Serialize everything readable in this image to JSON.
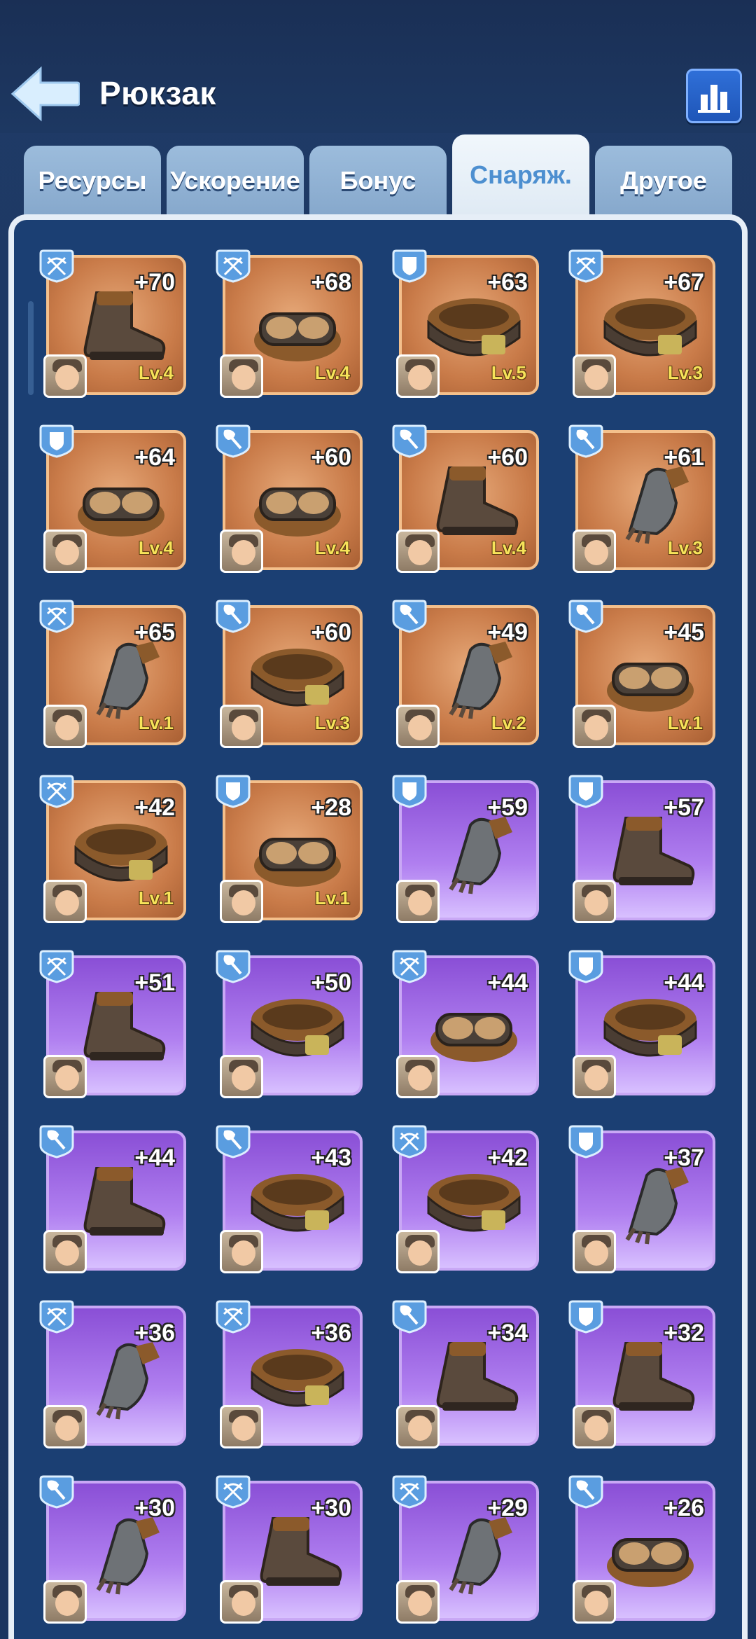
{
  "header": {
    "title": "Рюкзак",
    "back_icon": "back-arrow-icon",
    "stats_icon": "bar-chart-icon"
  },
  "tabs": [
    {
      "label": "Ресурсы",
      "active": false
    },
    {
      "label": "Ускорение",
      "active": false
    },
    {
      "label": "Бонус",
      "active": false
    },
    {
      "label": "Снаряж.",
      "active": true
    },
    {
      "label": "Другое",
      "active": false
    }
  ],
  "items": [
    {
      "bonus": "+70",
      "level": "Lv.4",
      "rarity": "orange",
      "type": "crossbow",
      "gear": "boot"
    },
    {
      "bonus": "+68",
      "level": "Lv.4",
      "rarity": "orange",
      "type": "crossbow",
      "gear": "goggles"
    },
    {
      "bonus": "+63",
      "level": "Lv.5",
      "rarity": "orange",
      "type": "shield",
      "gear": "belt"
    },
    {
      "bonus": "+67",
      "level": "Lv.3",
      "rarity": "orange",
      "type": "crossbow",
      "gear": "belt"
    },
    {
      "bonus": "+64",
      "level": "Lv.4",
      "rarity": "orange",
      "type": "shield",
      "gear": "goggles"
    },
    {
      "bonus": "+60",
      "level": "Lv.4",
      "rarity": "orange",
      "type": "shovel",
      "gear": "goggles"
    },
    {
      "bonus": "+60",
      "level": "Lv.4",
      "rarity": "orange",
      "type": "shovel",
      "gear": "boot"
    },
    {
      "bonus": "+61",
      "level": "Lv.3",
      "rarity": "orange",
      "type": "shovel",
      "gear": "glove"
    },
    {
      "bonus": "+65",
      "level": "Lv.1",
      "rarity": "orange",
      "type": "crossbow",
      "gear": "glove"
    },
    {
      "bonus": "+60",
      "level": "Lv.3",
      "rarity": "orange",
      "type": "shovel",
      "gear": "belt"
    },
    {
      "bonus": "+49",
      "level": "Lv.2",
      "rarity": "orange",
      "type": "shovel",
      "gear": "glove"
    },
    {
      "bonus": "+45",
      "level": "Lv.1",
      "rarity": "orange",
      "type": "shovel",
      "gear": "goggles"
    },
    {
      "bonus": "+42",
      "level": "Lv.1",
      "rarity": "orange",
      "type": "crossbow",
      "gear": "belt"
    },
    {
      "bonus": "+28",
      "level": "Lv.1",
      "rarity": "orange",
      "type": "shield",
      "gear": "goggles"
    },
    {
      "bonus": "+59",
      "level": "",
      "rarity": "purple",
      "type": "shield",
      "gear": "glove"
    },
    {
      "bonus": "+57",
      "level": "",
      "rarity": "purple",
      "type": "shield",
      "gear": "boot"
    },
    {
      "bonus": "+51",
      "level": "",
      "rarity": "purple",
      "type": "crossbow",
      "gear": "boot"
    },
    {
      "bonus": "+50",
      "level": "",
      "rarity": "purple",
      "type": "shovel",
      "gear": "belt"
    },
    {
      "bonus": "+44",
      "level": "",
      "rarity": "purple",
      "type": "crossbow",
      "gear": "goggles"
    },
    {
      "bonus": "+44",
      "level": "",
      "rarity": "purple",
      "type": "shield",
      "gear": "belt"
    },
    {
      "bonus": "+44",
      "level": "",
      "rarity": "purple",
      "type": "shovel",
      "gear": "boot"
    },
    {
      "bonus": "+43",
      "level": "",
      "rarity": "purple",
      "type": "shovel",
      "gear": "belt"
    },
    {
      "bonus": "+42",
      "level": "",
      "rarity": "purple",
      "type": "crossbow",
      "gear": "belt"
    },
    {
      "bonus": "+37",
      "level": "",
      "rarity": "purple",
      "type": "shield",
      "gear": "glove"
    },
    {
      "bonus": "+36",
      "level": "",
      "rarity": "purple",
      "type": "crossbow",
      "gear": "glove"
    },
    {
      "bonus": "+36",
      "level": "",
      "rarity": "purple",
      "type": "crossbow",
      "gear": "belt"
    },
    {
      "bonus": "+34",
      "level": "",
      "rarity": "purple",
      "type": "shovel",
      "gear": "boot"
    },
    {
      "bonus": "+32",
      "level": "",
      "rarity": "purple",
      "type": "shield",
      "gear": "boot"
    },
    {
      "bonus": "+30",
      "level": "",
      "rarity": "purple",
      "type": "shovel",
      "gear": "glove"
    },
    {
      "bonus": "+30",
      "level": "",
      "rarity": "purple",
      "type": "crossbow",
      "gear": "boot"
    },
    {
      "bonus": "+29",
      "level": "",
      "rarity": "purple",
      "type": "crossbow",
      "gear": "glove"
    },
    {
      "bonus": "+26",
      "level": "",
      "rarity": "purple",
      "type": "shovel",
      "gear": "goggles"
    }
  ]
}
